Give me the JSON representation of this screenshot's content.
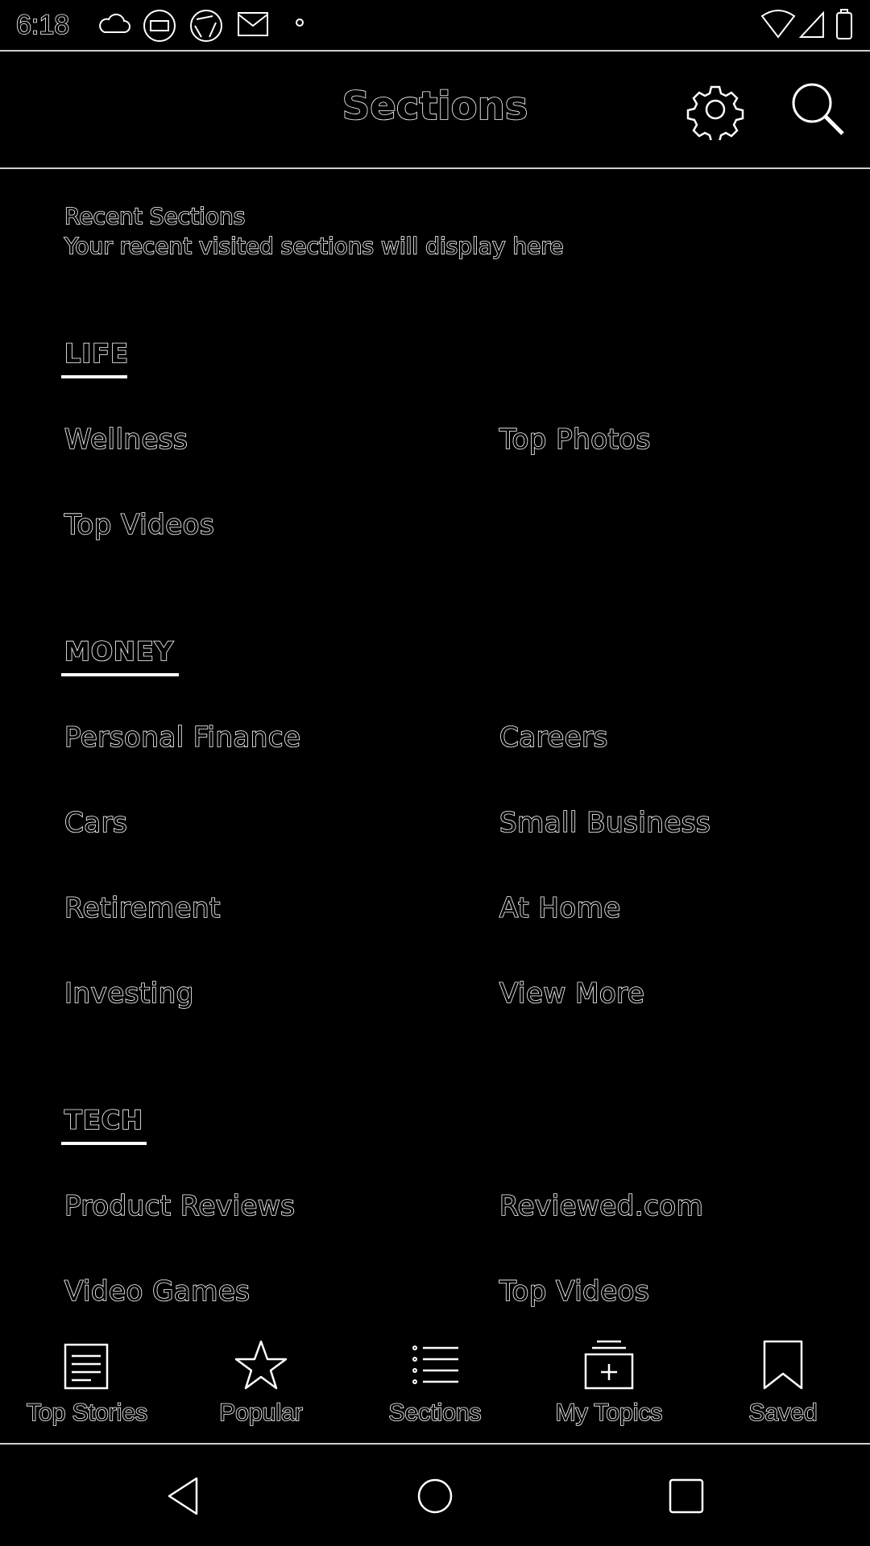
{
  "status_bar": {
    "time": "6:18"
  },
  "app_bar": {
    "title": "Sections"
  },
  "recent": {
    "title": "Recent Sections",
    "subtitle": "Your recent visited sections will display here"
  },
  "sections": [
    {
      "heading": "LIFE",
      "items": [
        "Wellness",
        "Top Photos",
        "Top Videos"
      ]
    },
    {
      "heading": "MONEY",
      "items": [
        "Personal Finance",
        "Careers",
        "Cars",
        "Small Business",
        "Retirement",
        "At Home",
        "Investing",
        "View More"
      ]
    },
    {
      "heading": "TECH",
      "items": [
        "Product Reviews",
        "Reviewed.com",
        "Video Games",
        "Top Videos"
      ]
    }
  ],
  "bottom_nav": [
    {
      "label": "Top Stories",
      "icon": "newspaper-icon"
    },
    {
      "label": "Popular",
      "icon": "star-icon"
    },
    {
      "label": "Sections",
      "icon": "list-icon"
    },
    {
      "label": "My Topics",
      "icon": "add-topic-icon"
    },
    {
      "label": "Saved",
      "icon": "bookmark-icon"
    }
  ],
  "colors": {
    "background": "#000000",
    "foreground": "#ffffff",
    "divider": "#cfcfcf"
  }
}
